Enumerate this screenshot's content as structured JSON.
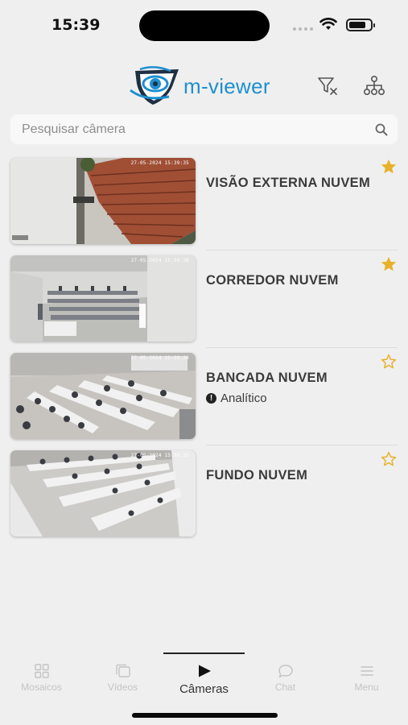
{
  "status_bar": {
    "time": "15:39"
  },
  "header": {
    "logo_text": "m-viewer"
  },
  "search": {
    "placeholder": "Pesquisar câmera"
  },
  "cameras": [
    {
      "title": "VISÃO EXTERNA NUVEM",
      "subtitle": "",
      "favorite": true,
      "timestamp": "27-05-2024 15:39:35"
    },
    {
      "title": "CORREDOR NUVEM",
      "subtitle": "",
      "favorite": true,
      "timestamp": "27-05-2024 15:39:36"
    },
    {
      "title": "BANCADA NUVEM",
      "subtitle": "Analítico",
      "favorite": false,
      "timestamp": "27-05-2024 15:39:36"
    },
    {
      "title": "FUNDO NUVEM",
      "subtitle": "",
      "favorite": false,
      "timestamp": "27-05-2024 15:39:35"
    }
  ],
  "tabs": [
    {
      "label": "Mosaicos",
      "icon": "grid-icon",
      "active": false
    },
    {
      "label": "Vídeos",
      "icon": "videos-icon",
      "active": false
    },
    {
      "label": "Câmeras",
      "icon": "play-icon",
      "active": true
    },
    {
      "label": "Chat",
      "icon": "chat-icon",
      "active": false
    },
    {
      "label": "Menu",
      "icon": "menu-icon",
      "active": false
    }
  ],
  "colors": {
    "star": "#e8b12a",
    "brand": "#1e8fd0",
    "background": "#efefef"
  }
}
